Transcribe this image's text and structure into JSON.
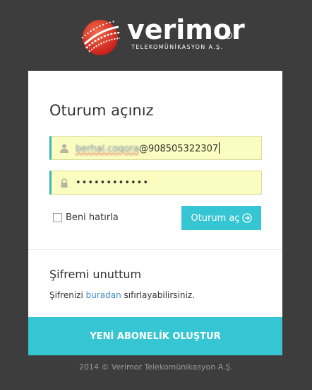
{
  "brand": {
    "name": "verimor",
    "registered": "R",
    "tagline": "TELEKOMÜNİKASYON A.Ş."
  },
  "login": {
    "title": "Oturum açınız",
    "email_blurred": "berhal.coqora",
    "email_suffix": "@908505322307",
    "password_value": "••••••••••••",
    "remember_label": "Beni hatırla",
    "submit_label": "Oturum aç"
  },
  "forgot": {
    "title": "Şifremi unuttum",
    "text_before": "Şifrenizi ",
    "link": "buradan",
    "text_after": " sıfırlayabilirsiniz."
  },
  "signup_label": "YENİ ABONELİK OLUŞTUR",
  "footer": "2014 © Verimor Telekomünikasyon A.Ş.",
  "colors": {
    "background": "#3d3d3d",
    "accent": "#36c6d3",
    "autofill": "#fbfdc0",
    "link": "#3f8fc7"
  },
  "icons": {
    "email": "user-icon",
    "password": "lock-icon",
    "submit": "arrow-circle-right-icon"
  }
}
